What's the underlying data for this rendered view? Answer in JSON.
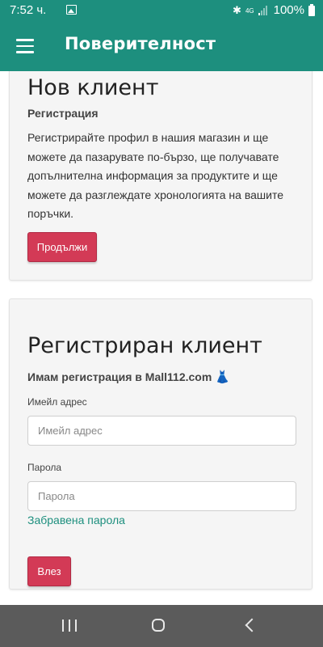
{
  "status_bar": {
    "time": "7:52 ч.",
    "network": "4G",
    "battery": "100%",
    "icons": [
      "image-icon",
      "bluetooth-icon",
      "signal-icon",
      "battery-icon"
    ]
  },
  "app_bar": {
    "title": "Поверителност",
    "menu_icon": "hamburger-menu-icon"
  },
  "new_customer": {
    "heading": "Нов клиент",
    "subheading": "Регистрация",
    "description": "Регистрирайте профил в нашия магазин и ще можете да пазарувате по-бързо, ще получавате допълнителна информация за продуктите и ще можете да разглеждате хронологията на вашите поръчки.",
    "button_label": "Продължи"
  },
  "registered_customer": {
    "heading": "Регистриран клиент",
    "subheading": "Имам регистрация в Mall112.com",
    "subheading_icon": "👗",
    "email_label": "Имейл адрес",
    "email_value": "",
    "email_placeholder": "Имейл адрес",
    "password_label": "Парола",
    "password_value": "",
    "password_placeholder": "Парола",
    "forgot_link": "Забравена парола",
    "login_button": "Влез"
  },
  "nav_bar": {
    "buttons": [
      "recent-apps-icon",
      "home-icon",
      "back-icon"
    ]
  },
  "colors": {
    "primary": "#1d8f7e",
    "button": "#d33a56",
    "card_bg": "#f5f5f5",
    "nav_bar": "#5b5b5b"
  }
}
